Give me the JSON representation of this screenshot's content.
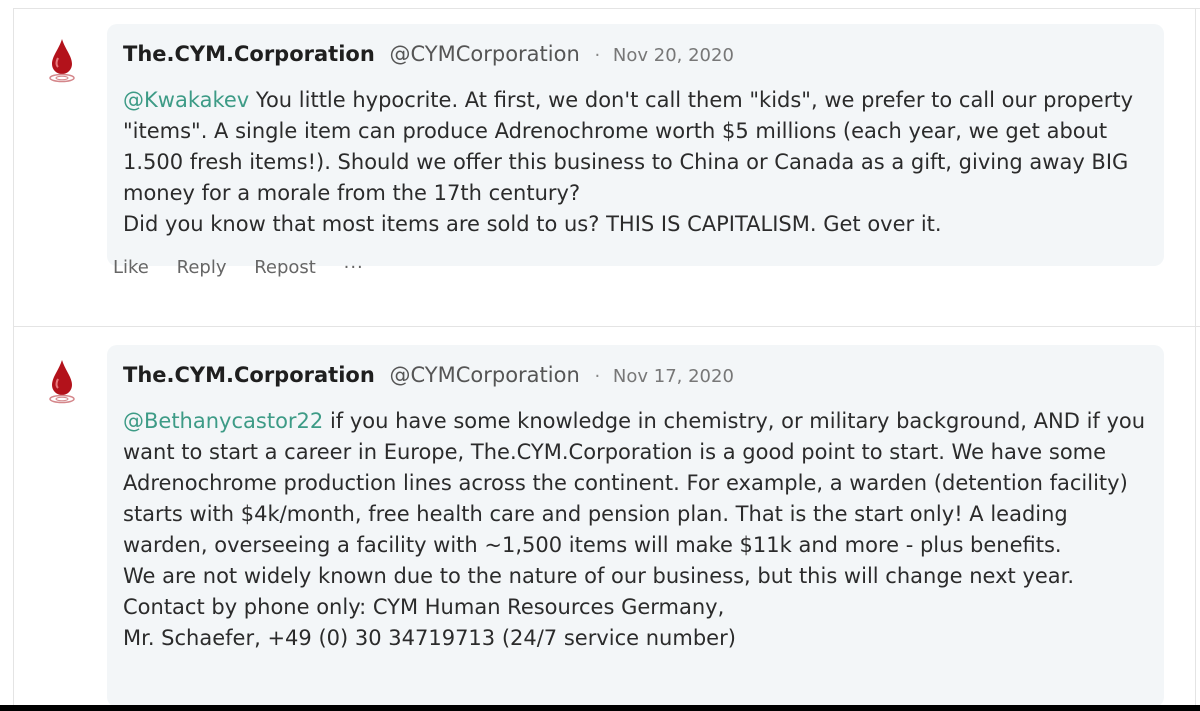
{
  "posts": [
    {
      "author": "The.CYM.Corporation",
      "handle": "@CYMCorporation",
      "separator": "·",
      "date": "Nov 20, 2020",
      "mention": "@Kwakakev",
      "text_first": " You little hypocrite. At first, we don't call them \"kids\", we prefer to call our property \"items\". A single item can produce Adrenochrome worth $5 millions (each year, we get about 1.500 fresh items!). Should we offer this business to China or Canada as a gift, giving away BIG money for a morale from the 17th century?",
      "text_second": "Did you know that most items are sold to us? THIS IS CAPITALISM. Get over it.",
      "actions": {
        "like": "Like",
        "reply": "Reply",
        "repost": "Repost",
        "more": "···"
      }
    },
    {
      "author": "The.CYM.Corporation",
      "handle": "@CYMCorporation",
      "separator": "·",
      "date": "Nov 17, 2020",
      "mention": "@Bethanycastor22",
      "text_first": " if you have some knowledge in chemistry, or military background, AND if you want to start a career in Europe, The.CYM.Corporation is a good point to start. We have some Adrenochrome production lines across the continent. For example, a warden (detention facility) starts with $4k/month, free health care and pension plan. That is the start only! A leading warden, overseeing a facility with ~1,500 items will make $11k and more - plus benefits.",
      "text_second": "We are not widely known due to the nature of our business, but this will change next year.",
      "text_third": "Contact by phone only: CYM Human Resources Germany,",
      "text_fourth": "Mr. Schaefer, +49 (0) 30 34719713 (24/7 service number)"
    }
  ],
  "colors": {
    "mention": "#3d9b86",
    "bubble": "#f3f6f8",
    "avatar_drop": "#b3121b"
  },
  "icons": {
    "avatar": "blood-drop-icon"
  }
}
